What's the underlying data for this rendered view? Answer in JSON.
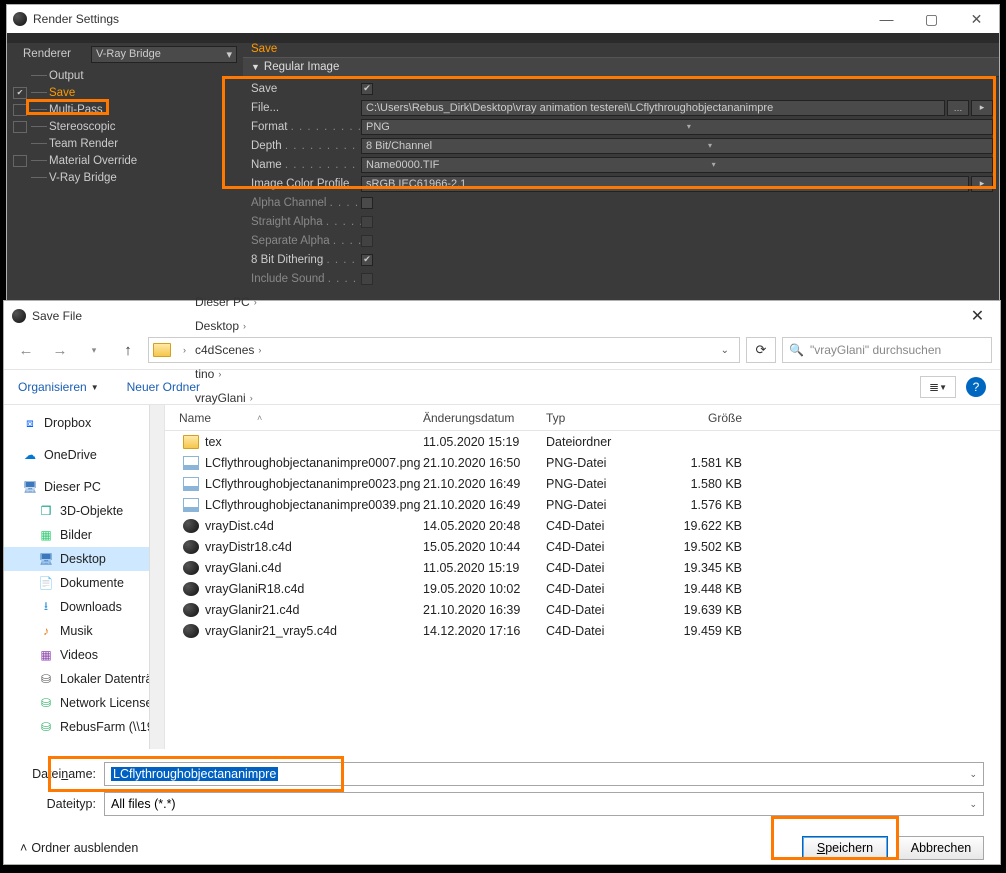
{
  "rs": {
    "title": "Render Settings",
    "renderer_label": "Renderer",
    "renderer_value": "V-Ray Bridge",
    "tree": [
      {
        "label": "Output",
        "chk": "blank"
      },
      {
        "label": "Save",
        "chk": "checked",
        "active": true
      },
      {
        "label": "Multi-Pass",
        "chk": "empty"
      },
      {
        "label": "Stereoscopic",
        "chk": "empty"
      },
      {
        "label": "Team Render",
        "chk": "blank"
      },
      {
        "label": "Material Override",
        "chk": "empty"
      },
      {
        "label": "V-Ray Bridge",
        "chk": "blank"
      }
    ],
    "tabhdr": "Save",
    "section": "Regular Image",
    "f": {
      "save_lbl": "Save",
      "file_lbl": "File...",
      "file_val": "C:\\Users\\Rebus_Dirk\\Desktop\\vray animation testerei\\LCflythroughobjectananimpre",
      "format_lbl": "Format",
      "format_val": "PNG",
      "depth_lbl": "Depth",
      "depth_val": "8 Bit/Channel",
      "name_lbl": "Name",
      "name_val": "Name0000.TIF",
      "icp_lbl": "Image Color Profile",
      "icp_val": "sRGB IEC61966-2.1",
      "alpha_lbl": "Alpha Channel",
      "straight_lbl": "Straight Alpha",
      "sep_lbl": "Separate Alpha",
      "dither_lbl": "8 Bit Dithering",
      "sound_lbl": "Include Sound"
    }
  },
  "sf": {
    "title": "Save File",
    "crumbs": [
      "Dieser PC",
      "Desktop",
      "c4dScenes",
      "tino",
      "vrayGlani"
    ],
    "search_placeholder": "\"vrayGlani\" durchsuchen",
    "organize": "Organisieren",
    "newfolder": "Neuer Ordner",
    "side": [
      {
        "ico": "dropbox",
        "label": "Dropbox",
        "ind": false
      },
      {
        "ico": "onedrive",
        "label": "OneDrive",
        "ind": false
      },
      {
        "ico": "pc",
        "label": "Dieser PC",
        "ind": false
      },
      {
        "ico": "obj3d",
        "label": "3D-Objekte",
        "ind": true
      },
      {
        "ico": "img",
        "label": "Bilder",
        "ind": true
      },
      {
        "ico": "pc",
        "label": "Desktop",
        "ind": true,
        "sel": true
      },
      {
        "ico": "doc",
        "label": "Dokumente",
        "ind": true
      },
      {
        "ico": "dl",
        "label": "Downloads",
        "ind": true
      },
      {
        "ico": "mus",
        "label": "Musik",
        "ind": true
      },
      {
        "ico": "vid",
        "label": "Videos",
        "ind": true
      },
      {
        "ico": "disk",
        "label": "Lokaler Datenträ",
        "ind": true
      },
      {
        "ico": "net",
        "label": "Network License",
        "ind": true
      },
      {
        "ico": "net",
        "label": "RebusFarm (\\\\19",
        "ind": true
      }
    ],
    "cols": {
      "name": "Name",
      "date": "Änderungsdatum",
      "type": "Typ",
      "size": "Größe"
    },
    "rows": [
      {
        "ico": "folder",
        "name": "tex",
        "date": "11.05.2020 15:19",
        "type": "Dateiordner",
        "size": ""
      },
      {
        "ico": "png",
        "name": "LCflythroughobjectananimpre0007.png",
        "date": "21.10.2020 16:50",
        "type": "PNG-Datei",
        "size": "1.581 KB"
      },
      {
        "ico": "png",
        "name": "LCflythroughobjectananimpre0023.png",
        "date": "21.10.2020 16:49",
        "type": "PNG-Datei",
        "size": "1.580 KB"
      },
      {
        "ico": "png",
        "name": "LCflythroughobjectananimpre0039.png",
        "date": "21.10.2020 16:49",
        "type": "PNG-Datei",
        "size": "1.576 KB"
      },
      {
        "ico": "c4d",
        "name": "vrayDist.c4d",
        "date": "14.05.2020 20:48",
        "type": "C4D-Datei",
        "size": "19.622 KB"
      },
      {
        "ico": "c4d",
        "name": "vrayDistr18.c4d",
        "date": "15.05.2020 10:44",
        "type": "C4D-Datei",
        "size": "19.502 KB"
      },
      {
        "ico": "c4d",
        "name": "vrayGlani.c4d",
        "date": "11.05.2020 15:19",
        "type": "C4D-Datei",
        "size": "19.345 KB"
      },
      {
        "ico": "c4d",
        "name": "vrayGlaniR18.c4d",
        "date": "19.05.2020 10:02",
        "type": "C4D-Datei",
        "size": "19.448 KB"
      },
      {
        "ico": "c4d",
        "name": "vrayGlanir21.c4d",
        "date": "21.10.2020 16:39",
        "type": "C4D-Datei",
        "size": "19.639 KB"
      },
      {
        "ico": "c4d",
        "name": "vrayGlanir21_vray5.c4d",
        "date": "14.12.2020 17:16",
        "type": "C4D-Datei",
        "size": "19.459 KB"
      }
    ],
    "filename_lbl": "Dateiname:",
    "filename_lbl_html": "Datei<u>n</u>ame:",
    "filename_val": "LCflythroughobjectananimpre",
    "filetype_lbl": "Dateityp:",
    "filetype_val": "All files (*.*)",
    "hide": "Ordner ausblenden",
    "save_btn": "Speichern",
    "cancel_btn": "Abbrechen"
  }
}
